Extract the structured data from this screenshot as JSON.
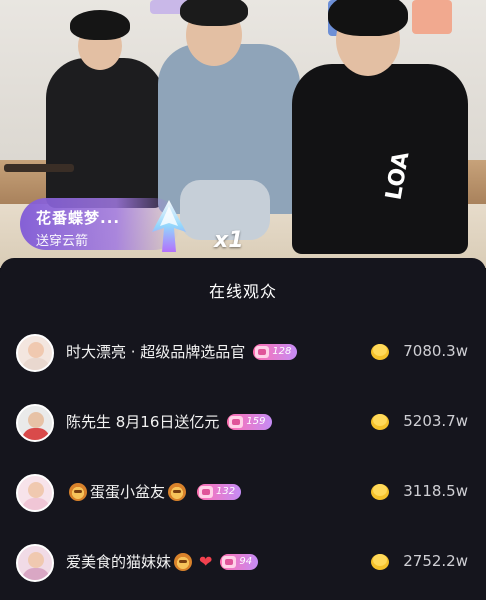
{
  "gift": {
    "name": "花番蝶梦...",
    "desc": "送穿云箭",
    "count": "x1"
  },
  "panel": {
    "title": "在线观众",
    "viewers": [
      {
        "name": "时大漂亮 · 超级品牌选品官",
        "prefix_emoji": "",
        "suffix_emoji": "",
        "heart": "",
        "level": "128",
        "value": "7080.3w",
        "avatar_color": "#e9d8cf"
      },
      {
        "name": "陈先生 8月16日送亿元",
        "prefix_emoji": "",
        "suffix_emoji": "",
        "heart": "",
        "level": "159",
        "value": "5203.7w",
        "avatar_color": "#d94a4a"
      },
      {
        "name": "蛋蛋小盆友",
        "prefix_emoji": "lion-emoji",
        "suffix_emoji": "lion-emoji",
        "heart": "",
        "level": "132",
        "value": "3118.5w",
        "avatar_color": "#f0c6d6"
      },
      {
        "name": "爱美食的猫妹妹",
        "prefix_emoji": "",
        "suffix_emoji": "lion-emoji",
        "heart": "❤",
        "level": "94",
        "value": "2752.2w",
        "avatar_color": "#d9a7c4"
      }
    ]
  },
  "colors": {
    "panel_bg": "#15151d",
    "gift_banner": "#805ad7",
    "badge_gradient": [
      "#ff6fb0",
      "#c58cf5"
    ],
    "coin": "#f4c12b"
  }
}
